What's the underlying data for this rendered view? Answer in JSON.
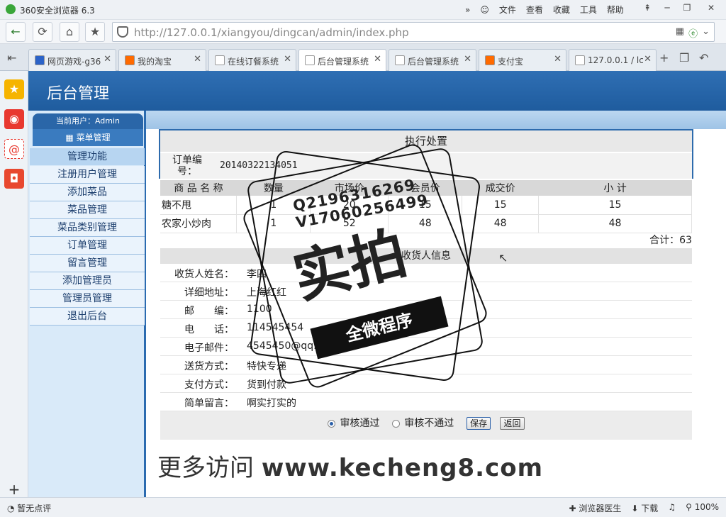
{
  "browser": {
    "title": "360安全浏览器 6.3",
    "menus": [
      "文件",
      "查看",
      "收藏",
      "工具",
      "帮助"
    ],
    "url_host": "http://127.0.0.1",
    "url_path": "/xiangyou/dingcan/admin/index.php",
    "tabs": [
      {
        "label": "网页游戏-g36",
        "color": "#2b63c8"
      },
      {
        "label": "我的淘宝",
        "color": "#ff6a00"
      },
      {
        "label": "在线订餐系统",
        "color": "#ffffff"
      },
      {
        "label": "后台管理系统",
        "color": "#ffffff"
      },
      {
        "label": "后台管理系统",
        "color": "#ffffff"
      },
      {
        "label": "支付宝",
        "color": "#ff6a00"
      },
      {
        "label": "127.0.0.1 / lc",
        "color": "#ffffff"
      }
    ],
    "active_tab": 3,
    "status_left": "暂无点评",
    "status_right": [
      "浏览器医生",
      "下载",
      "100%"
    ]
  },
  "app": {
    "header": "后台管理",
    "user_label": "当前用户：Admin",
    "menu_header": "菜单管理",
    "section_title": "管理功能",
    "menu_items": [
      "注册用户管理",
      "添加菜品",
      "菜品管理",
      "菜品类别管理",
      "订单管理",
      "留言管理",
      "添加管理员",
      "管理员管理",
      "退出后台"
    ]
  },
  "order": {
    "box_title": "执行处置",
    "order_no_label": "订单编号：",
    "order_no": "20140322134051",
    "columns": [
      "商 品 名 称",
      "数量",
      "市场价",
      "会员价",
      "成交价",
      "小 计"
    ],
    "items": [
      {
        "name": "糖不甩",
        "qty": "1",
        "market": "20",
        "member": "15",
        "deal": "15",
        "subtotal": "15"
      },
      {
        "name": "农家小炒肉",
        "qty": "1",
        "market": "52",
        "member": "48",
        "deal": "48",
        "subtotal": "48"
      }
    ],
    "total": "合计：63",
    "recv_title": "收货人信息",
    "recv": [
      {
        "label": "收货人姓名：",
        "value": "李四"
      },
      {
        "label": "详细地址：",
        "value": "上海红红"
      },
      {
        "label": "邮　　编：",
        "value": "1100"
      },
      {
        "label": "电　　话：",
        "value": "114545454"
      },
      {
        "label": "电子邮件：",
        "value": "4545450@qq.com"
      },
      {
        "label": "送货方式：",
        "value": "特快专递"
      },
      {
        "label": "支付方式：",
        "value": "货到付款"
      },
      {
        "label": "简单留言：",
        "value": "啊实打实的"
      }
    ],
    "approve_label": "审核通过",
    "reject_label": "审核不通过",
    "save_label": "保存",
    "back_label": "返回"
  },
  "watermark": {
    "qq": "Q2196316269",
    "vx": "V17060256499",
    "big": "实拍",
    "band": "全微程序",
    "more_prefix": "更多访问",
    "more_site": "www.kecheng8.com"
  }
}
